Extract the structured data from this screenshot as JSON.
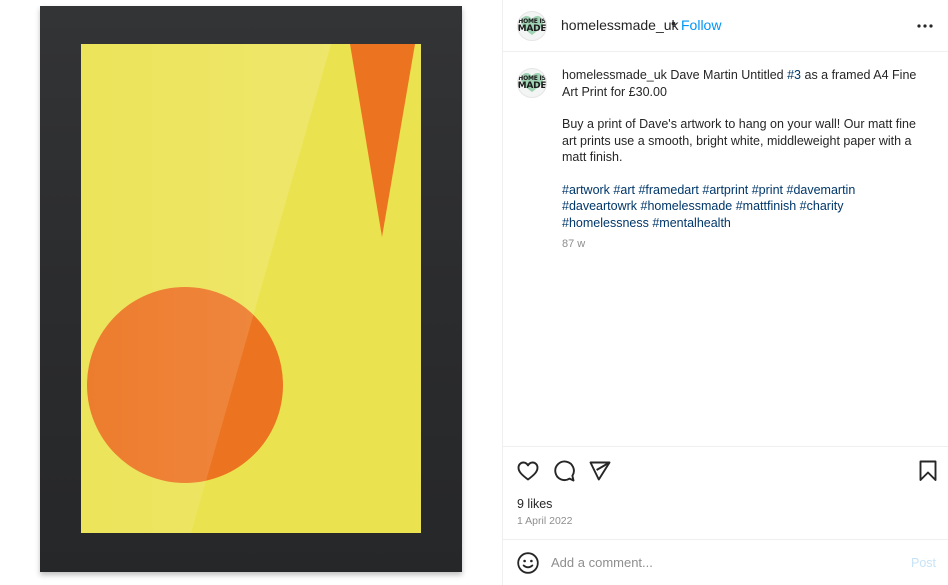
{
  "post": {
    "image_alt": "Framed A4 print: yellow background with orange circle and orange inverted triangle",
    "artwork_colors": {
      "background": "#ebe24f",
      "shapes": "#ec7420",
      "frame": "#2a2b2d"
    }
  },
  "header": {
    "avatar_label": {
      "top": "HOME IS",
      "bottom": "MADE"
    },
    "username": "homelessmade_uk",
    "separator": "•",
    "follow_label": "Follow",
    "more_icon": "more-horizontal-icon"
  },
  "caption": {
    "username": "homelessmade_uk",
    "text_before_tag": " Dave Martin Untitled ",
    "inline_tag": "#3",
    "text_after_tag": " as a framed A4 Fine Art Print for £30.00",
    "body": "Buy a print of Dave's artwork to hang on your wall! Our matt fine art prints use a smooth, bright white, middleweight paper with a matt finish.",
    "hashtags": [
      "#artwork",
      "#art",
      "#framedart",
      "#artprint",
      "#print",
      "#davemartin",
      "#daveartowrk",
      "#homelessmade",
      "#mattfinish",
      "#charity",
      "#homelessness",
      "#mentalhealth"
    ],
    "age": "87 w"
  },
  "actions": {
    "icons": [
      "heart-icon",
      "comment-icon",
      "share-icon",
      "bookmark-icon"
    ],
    "likes": "9 likes",
    "date": "1 April 2022"
  },
  "comment": {
    "emoji_icon": "emoji-icon",
    "placeholder": "Add a comment...",
    "value": "",
    "post_label": "Post"
  },
  "colors": {
    "link_blue": "#0095f6",
    "hashtag": "#00376b",
    "muted": "#8e8e8e",
    "post_disabled": "#c7e3f8"
  }
}
